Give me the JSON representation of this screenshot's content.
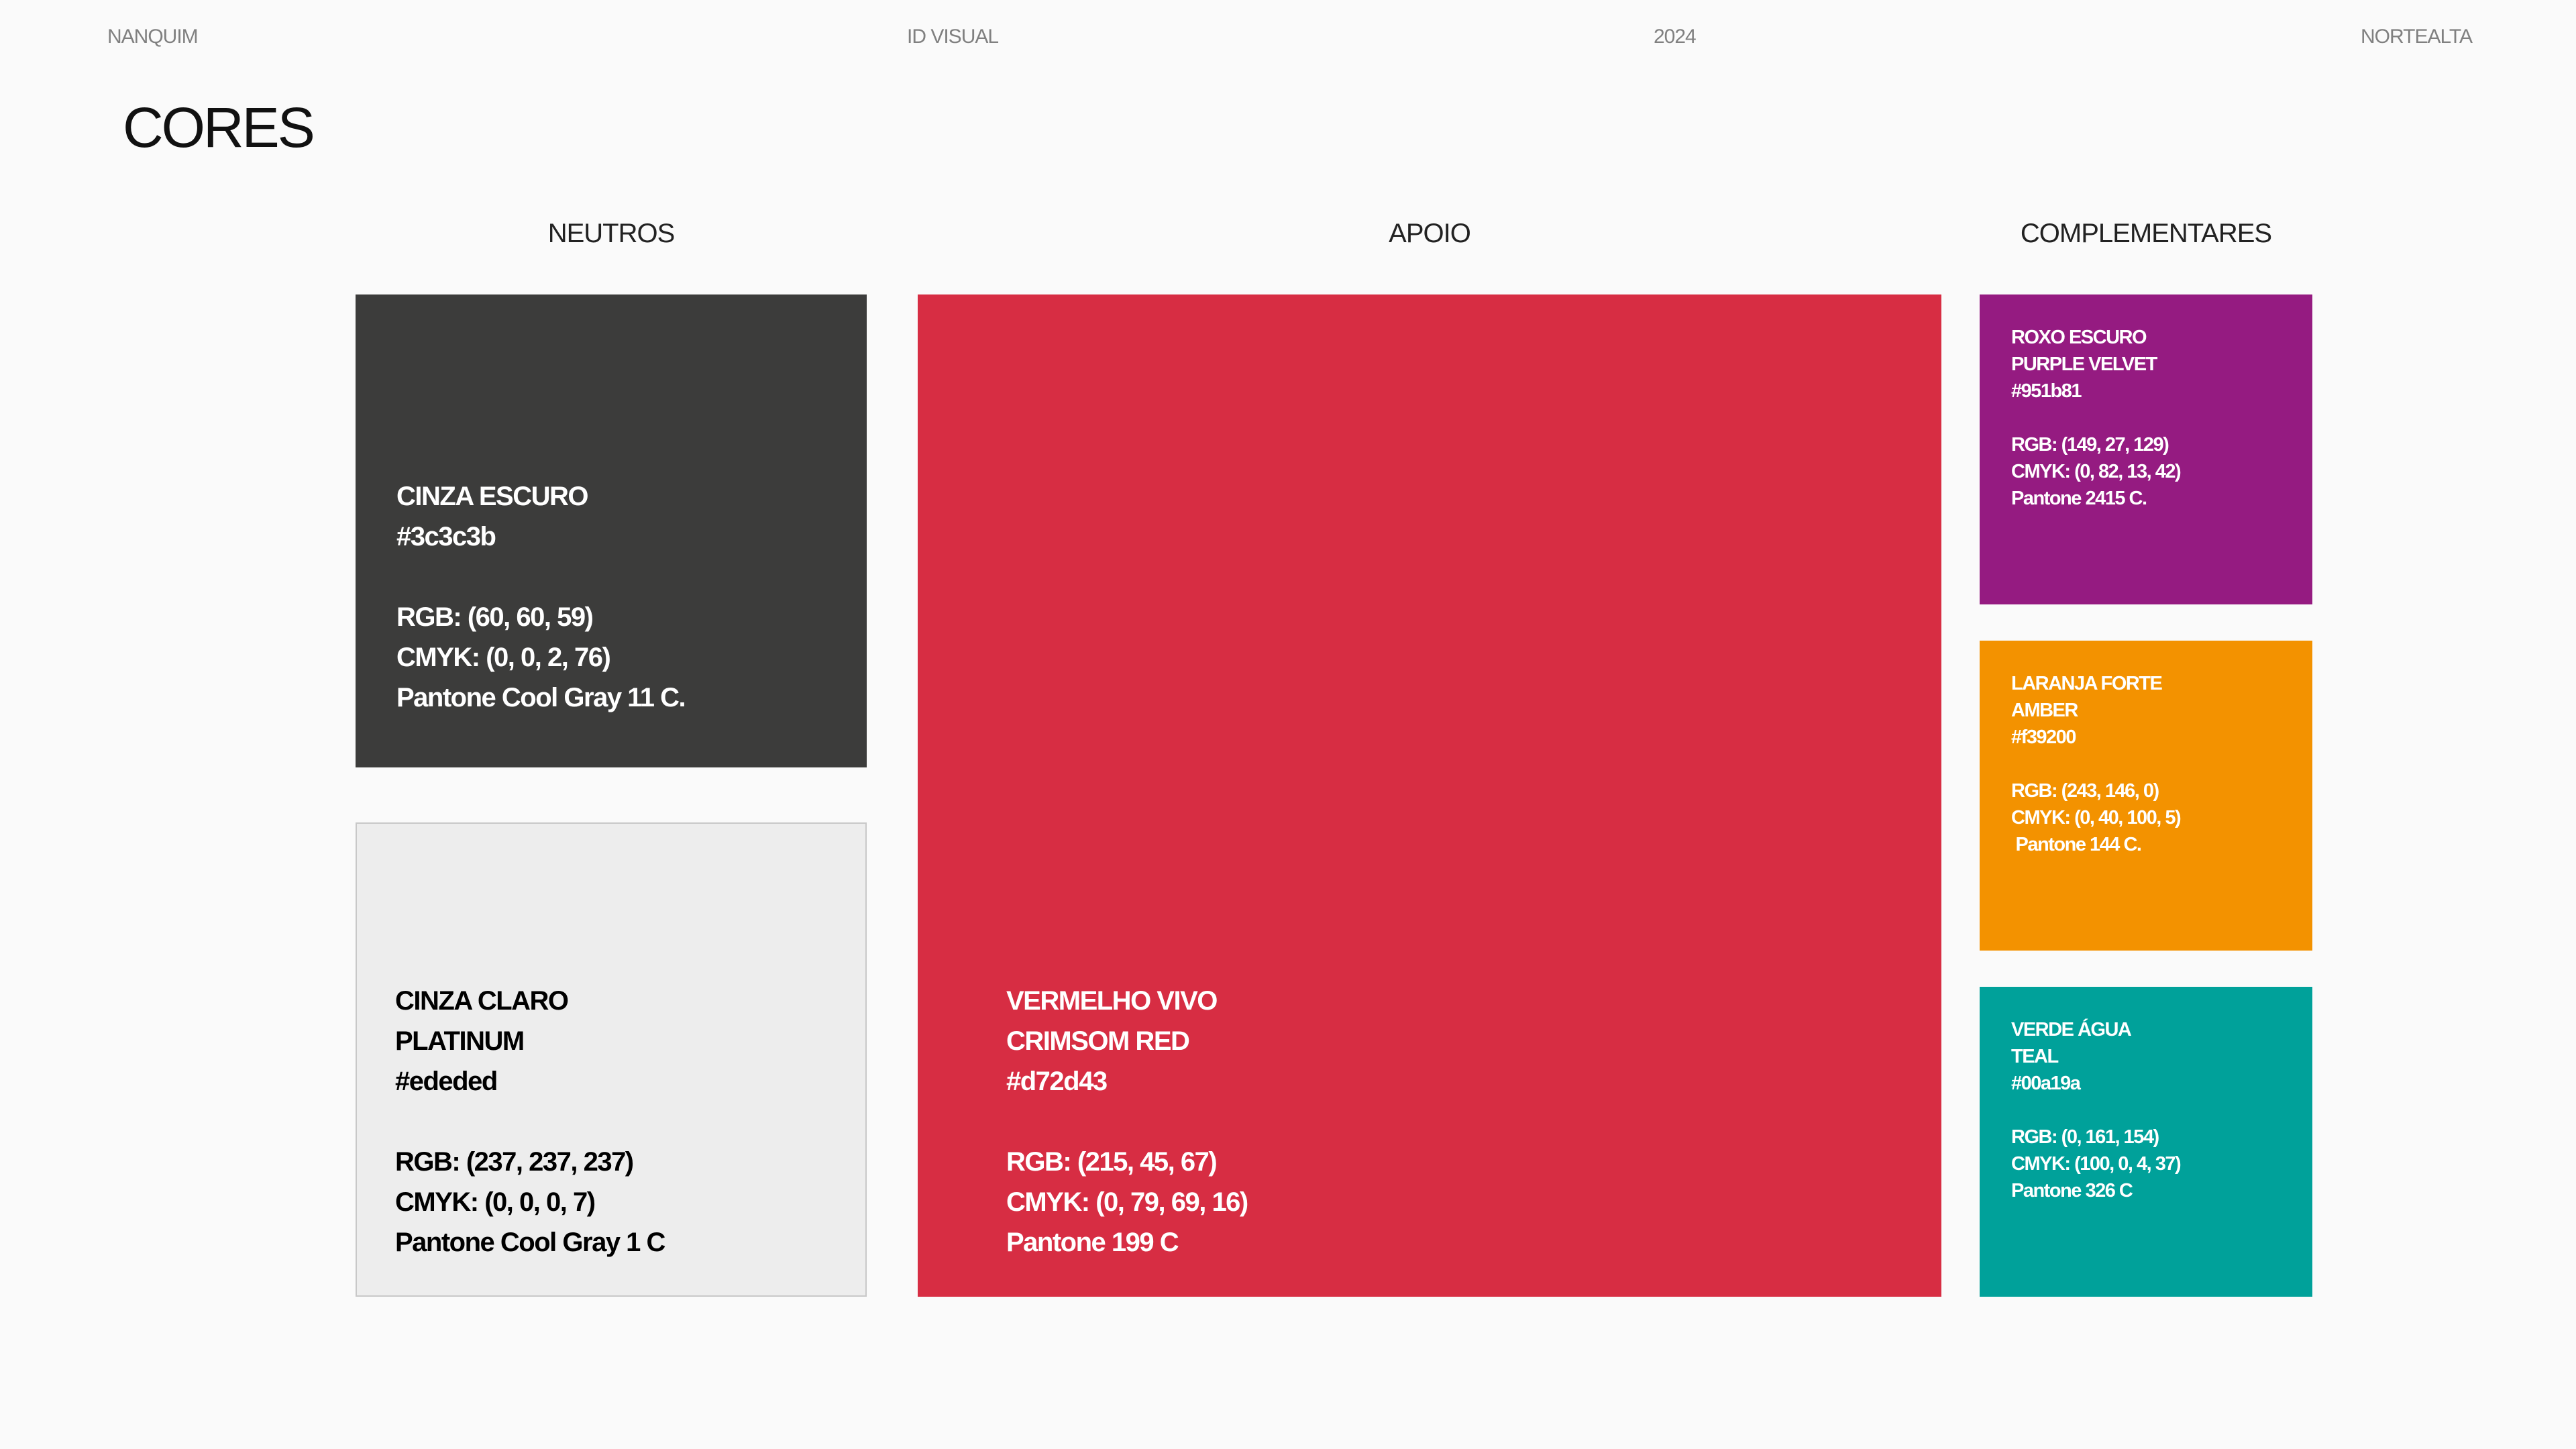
{
  "header": {
    "left": "NANQUIM",
    "center_left": "ID VISUAL",
    "center_right": "2024",
    "right": "NORTEALTA"
  },
  "page_title": "CORES",
  "groups": {
    "neutros": "NEUTROS",
    "apoio": "APOIO",
    "complementares": "COMPLEMENTARES"
  },
  "swatches": {
    "cinza_escuro": {
      "color": "#3c3c3b",
      "text_color": "#ffffff",
      "name": "CINZA ESCURO",
      "hex": "#3c3c3b",
      "rgb": "RGB: (60, 60, 59)",
      "cmyk": "CMYK: (0, 0, 2, 76)",
      "pantone": "Pantone Cool Gray 11 C."
    },
    "cinza_claro": {
      "color": "#ededed",
      "text_color": "#000000",
      "name": "CINZA CLARO",
      "alt_name": "PLATINUM",
      "hex": "#ededed",
      "rgb": "RGB: (237, 237, 237)",
      "cmyk": "CMYK: (0, 0, 0, 7)",
      "pantone": "Pantone Cool Gray 1 C"
    },
    "vermelho_vivo": {
      "color": "#d72d43",
      "text_color": "#ffffff",
      "name": "VERMELHO VIVO",
      "alt_name": "CRIMSOM RED",
      "hex": "#d72d43",
      "rgb": "RGB: (215, 45, 67)",
      "cmyk": "CMYK: (0, 79, 69, 16)",
      "pantone": "Pantone 199 C"
    },
    "roxo_escuro": {
      "color": "#951b81",
      "text_color": "#ffffff",
      "name": "ROXO ESCURO",
      "alt_name": "PURPLE VELVET",
      "hex": "#951b81",
      "rgb": "RGB: (149, 27, 129)",
      "cmyk": "CMYK: (0, 82, 13, 42)",
      "pantone": "Pantone 2415 C."
    },
    "laranja_forte": {
      "color": "#f39200",
      "text_color": "#ffffff",
      "name": "LARANJA FORTE",
      "alt_name": "AMBER",
      "hex": "#f39200",
      "rgb": "RGB: (243, 146, 0)",
      "cmyk": "CMYK: (0, 40, 100, 5)",
      "pantone": " Pantone 144 C."
    },
    "verde_agua": {
      "color": "#00a19a",
      "text_color": "#ffffff",
      "name": "VERDE ÁGUA",
      "alt_name": "TEAL",
      "hex": "#00a19a",
      "rgb": "RGB: (0, 161, 154)",
      "cmyk": "CMYK: (100, 0, 4, 37)",
      "pantone": "Pantone 326 C"
    }
  }
}
